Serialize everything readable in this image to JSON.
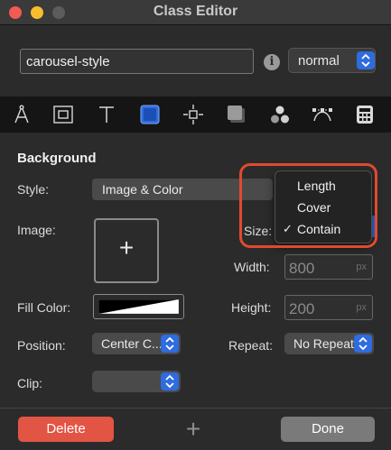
{
  "window": {
    "title": "Class Editor"
  },
  "header": {
    "class_name": "carousel-style",
    "info_glyph": "i",
    "state_select": "normal"
  },
  "toolbar": {
    "icons": [
      "compass-icon",
      "box-model-icon",
      "typography-icon",
      "background-icon",
      "position-icon",
      "border-icon",
      "effects-icon",
      "transform-icon",
      "calculator-icon"
    ],
    "active": "background-icon"
  },
  "background": {
    "section_title": "Background",
    "style_label": "Style:",
    "style_value": "Image & Color",
    "image_label": "Image:",
    "image_add_glyph": "+",
    "size_label": "Size:",
    "width_label": "Width:",
    "width_value": "800",
    "width_unit": "px",
    "fill_label": "Fill Color:",
    "height_label": "Height:",
    "height_value": "200",
    "height_unit": "px",
    "position_label": "Position:",
    "position_value": "Center C...",
    "repeat_label": "Repeat:",
    "repeat_value": "No Repeat",
    "clip_label": "Clip:",
    "clip_value": ""
  },
  "size_menu": {
    "items": [
      {
        "label": "Length",
        "checked": false
      },
      {
        "label": "Cover",
        "checked": false
      },
      {
        "label": "Contain",
        "checked": true
      }
    ],
    "check_glyph": "✓"
  },
  "footer": {
    "delete_label": "Delete",
    "add_glyph": "+",
    "done_label": "Done"
  },
  "colors": {
    "accent": "#2e6ce0",
    "delete": "#e25544",
    "highlight_ring": "#e04a2f"
  }
}
